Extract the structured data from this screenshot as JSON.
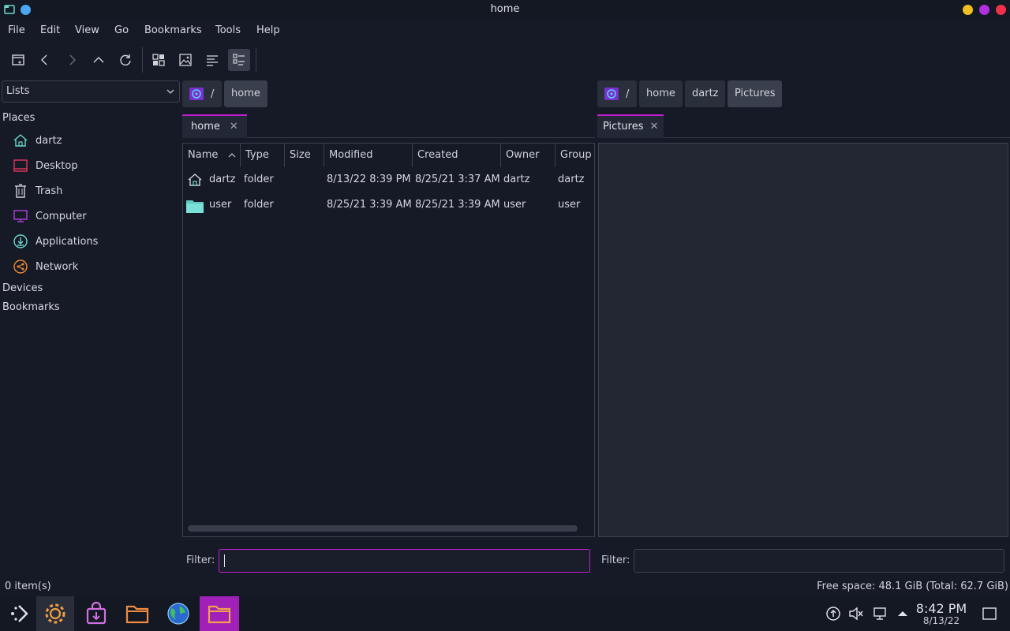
{
  "window": {
    "title": "home"
  },
  "menu": [
    "File",
    "Edit",
    "View",
    "Go",
    "Bookmarks",
    "Tools",
    "Help"
  ],
  "left_panel": {
    "select_value": "Lists",
    "places_header": "Places",
    "places": [
      "dartz",
      "Desktop",
      "Trash",
      "Computer",
      "Applications",
      "Network"
    ],
    "devices_header": "Devices",
    "bookmarks_header": "Bookmarks"
  },
  "left_pane": {
    "breadcrumb_root": "/",
    "breadcrumbs": [
      "home"
    ],
    "tab_label": "home",
    "columns": [
      "Name",
      "Type",
      "Size",
      "Modified",
      "Created",
      "Owner",
      "Group"
    ],
    "rows": [
      {
        "name": "dartz",
        "type": "folder",
        "size": "",
        "modified": "8/13/22 8:39 PM",
        "created": "8/25/21 3:37 AM",
        "owner": "dartz",
        "group": "dartz",
        "icon": "home-folder-icon"
      },
      {
        "name": "user",
        "type": "folder",
        "size": "",
        "modified": "8/25/21 3:39 AM",
        "created": "8/25/21 3:39 AM",
        "owner": "user",
        "group": "user",
        "icon": "folder-icon"
      }
    ],
    "filter_label": "Filter:",
    "filter_value": ""
  },
  "right_pane": {
    "breadcrumb_root": "/",
    "breadcrumbs": [
      "home",
      "dartz",
      "Pictures"
    ],
    "tab_label": "Pictures",
    "filter_label": "Filter:",
    "filter_value": ""
  },
  "status": {
    "items": "0 item(s)",
    "free_space": "Free space: 48.1 GiB (Total: 62.7 GiB)"
  },
  "taskbar": {
    "time": "8:42 PM",
    "date": "8/13/22"
  },
  "colors": {
    "accent": "#c020d0",
    "teal": "#6ad6cc",
    "background": "#161a26"
  }
}
